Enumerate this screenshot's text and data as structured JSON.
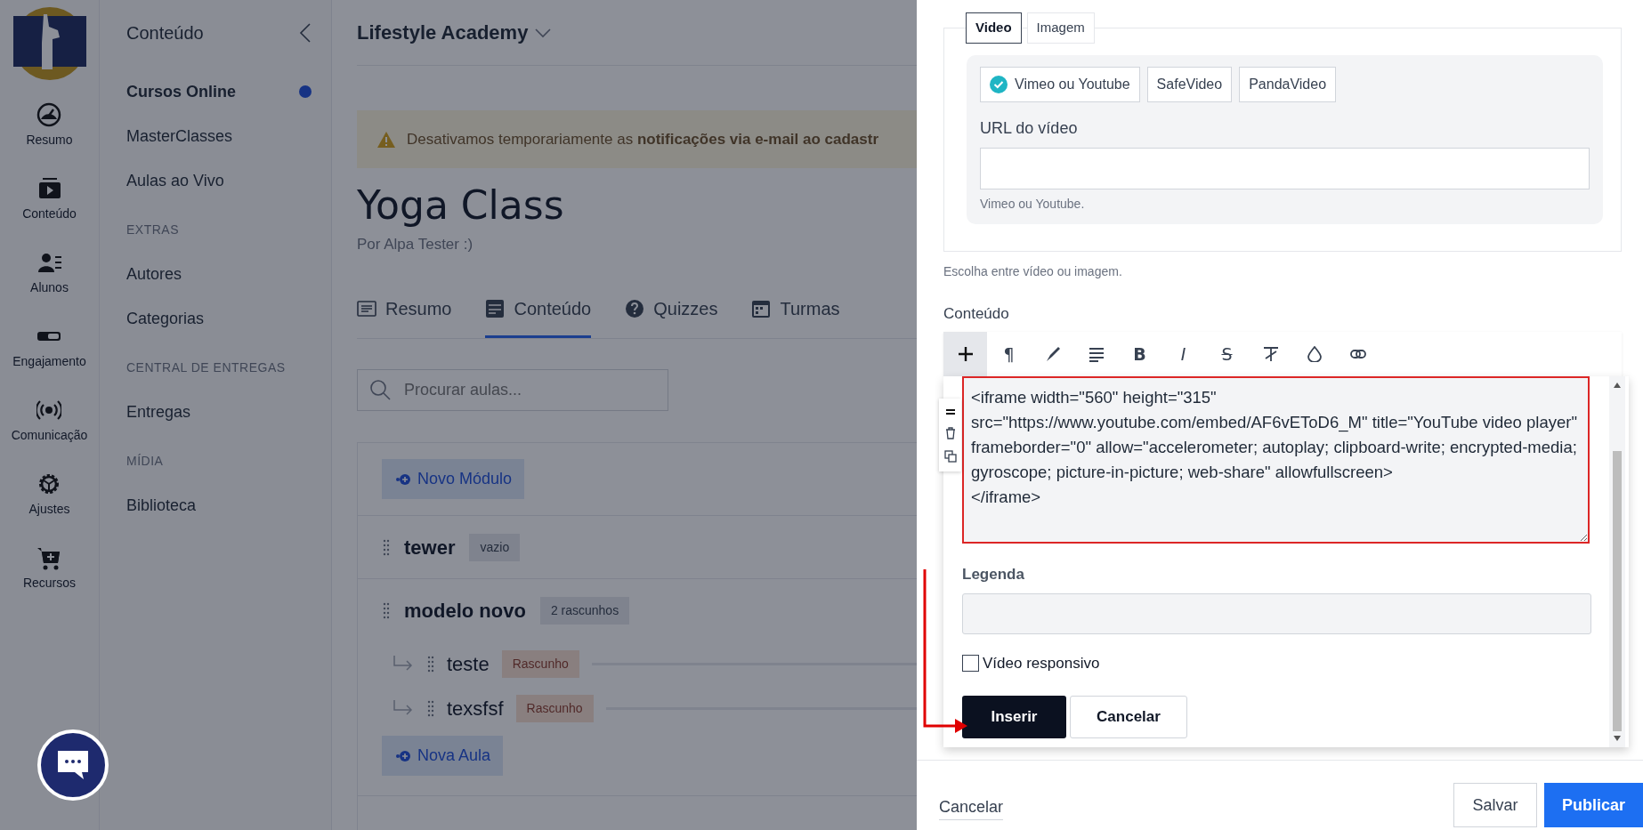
{
  "rail": {
    "items": [
      {
        "label": "Resumo",
        "kind": "gauge"
      },
      {
        "label": "Conteúdo",
        "kind": "video"
      },
      {
        "label": "Alunos",
        "kind": "users"
      },
      {
        "label": "Engajamento",
        "kind": "toggle"
      },
      {
        "label": "Comunicação",
        "kind": "broadcast"
      },
      {
        "label": "Ajustes",
        "kind": "gear"
      },
      {
        "label": "Recursos",
        "kind": "cart"
      }
    ]
  },
  "submenu": {
    "title": "Conteúdo",
    "sections": [
      {
        "items": [
          {
            "label": "Cursos Online",
            "selected": true
          },
          {
            "label": "MasterClasses",
            "selected": false
          },
          {
            "label": "Aulas ao Vivo",
            "selected": false
          }
        ]
      },
      {
        "heading": "EXTRAS",
        "items": [
          {
            "label": "Autores",
            "selected": false
          },
          {
            "label": "Categorias",
            "selected": false
          }
        ]
      },
      {
        "heading": "CENTRAL DE ENTREGAS",
        "items": [
          {
            "label": "Entregas",
            "selected": false
          }
        ]
      },
      {
        "heading": "MÍDIA",
        "items": [
          {
            "label": "Biblioteca",
            "selected": false
          }
        ]
      }
    ]
  },
  "main": {
    "school": "Lifestyle Academy",
    "alert": "Desativamos temporariamente as **notificações via e-mail ao cadastr**",
    "course": {
      "title": "Yoga Class",
      "author": "Por Alpa Tester :)"
    },
    "tabs": [
      {
        "label": "Resumo",
        "kind": "doc",
        "selected": false
      },
      {
        "label": "Conteúdo",
        "kind": "stack",
        "selected": true
      },
      {
        "label": "Quizzes",
        "kind": "question",
        "selected": false
      },
      {
        "label": "Turmas",
        "kind": "calendar",
        "selected": false
      }
    ],
    "search": {
      "placeholder": "Procurar aulas..."
    },
    "new_module": "Novo Módulo",
    "modules": [
      {
        "title": "tewer",
        "badge": "vazio"
      },
      {
        "title": "modelo novo",
        "badge": "2 rascunhos",
        "lessons": [
          {
            "title": "teste",
            "badge": "Rascunho"
          },
          {
            "title": "texsfsf",
            "badge": "Rascunho"
          }
        ],
        "new_lesson": "Nova Aula"
      }
    ]
  },
  "panel": {
    "media_tabs": [
      {
        "label": "Video",
        "selected": true
      },
      {
        "label": "Imagem",
        "selected": false
      }
    ],
    "providers": [
      {
        "label": "Vimeo ou Youtube",
        "selected": true
      },
      {
        "label": "SafeVideo",
        "selected": false
      },
      {
        "label": "PandaVideo",
        "selected": false
      }
    ],
    "url_label": "URL do vídeo",
    "url_hint": "Vimeo ou Youtube.",
    "media_hint": "Escolha entre vídeo ou imagem.",
    "content_label": "Conteúdo",
    "toolbar": [
      {
        "kind": "plus",
        "selected": true
      },
      {
        "kind": "paragraph",
        "glyph": "¶",
        "selected": false
      },
      {
        "kind": "pen",
        "selected": false
      },
      {
        "kind": "align",
        "selected": false
      },
      {
        "kind": "bold",
        "glyph": "B",
        "selected": false
      },
      {
        "kind": "italic",
        "glyph": "I",
        "selected": false
      },
      {
        "kind": "strike",
        "glyph": "S",
        "selected": false
      },
      {
        "kind": "clear",
        "selected": false
      },
      {
        "kind": "drop",
        "selected": false
      },
      {
        "kind": "link",
        "selected": false
      }
    ],
    "embed": {
      "code": "<iframe width=\"560\" height=\"315\" src=\"https://www.youtube.com/embed/AF6vEToD6_M\" title=\"YouTube video player\" frameborder=\"0\" allow=\"accelerometer; autoplay; clipboard-write; encrypted-media; gyroscope; picture-in-picture; web-share\" allowfullscreen>\n</iframe>",
      "caption_label": "Legenda",
      "responsive": {
        "label": "Vídeo responsivo",
        "checked": false
      },
      "buttons": [
        {
          "label": "Inserir",
          "kind": "primary"
        },
        {
          "label": "Cancelar",
          "kind": "secondary"
        }
      ]
    },
    "footer": {
      "cancel": "Cancelar",
      "buttons": [
        {
          "label": "Salvar",
          "kind": "outline"
        },
        {
          "label": "Publicar",
          "kind": "primary"
        }
      ]
    }
  }
}
